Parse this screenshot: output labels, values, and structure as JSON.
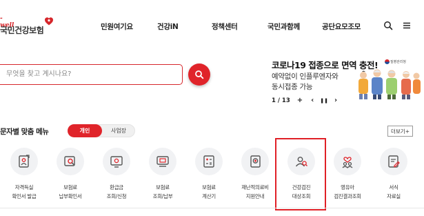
{
  "header": {
    "logo_eng": "-well",
    "logo_kor": "국민건강보험",
    "nav": [
      "민원여기요",
      "건강iN",
      "정책센터",
      "국민과함께",
      "공단요모조모"
    ],
    "icons": [
      "search-icon",
      "menu-icon"
    ]
  },
  "search": {
    "placeholder": "무엇을 찾고 계시나요?",
    "value": "",
    "button_icon": "search-icon"
  },
  "banner": {
    "title": "코로나19 접종으로 면역 충전!",
    "line1": "예약없이 인플루엔자와",
    "line2": "동시접종 가능",
    "agency": "질병관리청",
    "pager": {
      "current": "1",
      "total": "13",
      "label": "1 / 13"
    },
    "controls": {
      "add": "+",
      "prev": "‹",
      "pause": "❚❚",
      "next": "›"
    }
  },
  "menu": {
    "title": "문자별 맞춤 메뉴",
    "toggle": [
      "개인",
      "사업장"
    ],
    "selected": "개인",
    "more": "더보기+",
    "items": [
      {
        "line1": "자격득실",
        "line2": "확인서 발급",
        "icon": "certificate-icon"
      },
      {
        "line1": "보험료",
        "line2": "납부확인서",
        "icon": "document-search-icon"
      },
      {
        "line1": "환급금",
        "line2": "조회/신청",
        "icon": "refund-icon"
      },
      {
        "line1": "보험료",
        "line2": "조회/납부",
        "icon": "payment-icon"
      },
      {
        "line1": "보험료",
        "line2": "계산기",
        "icon": "calculator-icon"
      },
      {
        "line1": "재난적의료비",
        "line2": "지원안내",
        "icon": "medical-support-icon"
      },
      {
        "line1": "건강검진",
        "line2": "대상조회",
        "icon": "health-checkup-icon"
      },
      {
        "line1": "영유아",
        "line2": "검진결과조회",
        "icon": "infant-icon"
      },
      {
        "line1": "서식",
        "line2": "자료실",
        "icon": "forms-icon"
      }
    ],
    "highlighted_item": "건강검진 대상조회"
  },
  "colors": {
    "accent": "#e0242a",
    "text": "#222222",
    "icon_bg": "#f1f2f4",
    "agency_blue": "#1c4f9c"
  }
}
